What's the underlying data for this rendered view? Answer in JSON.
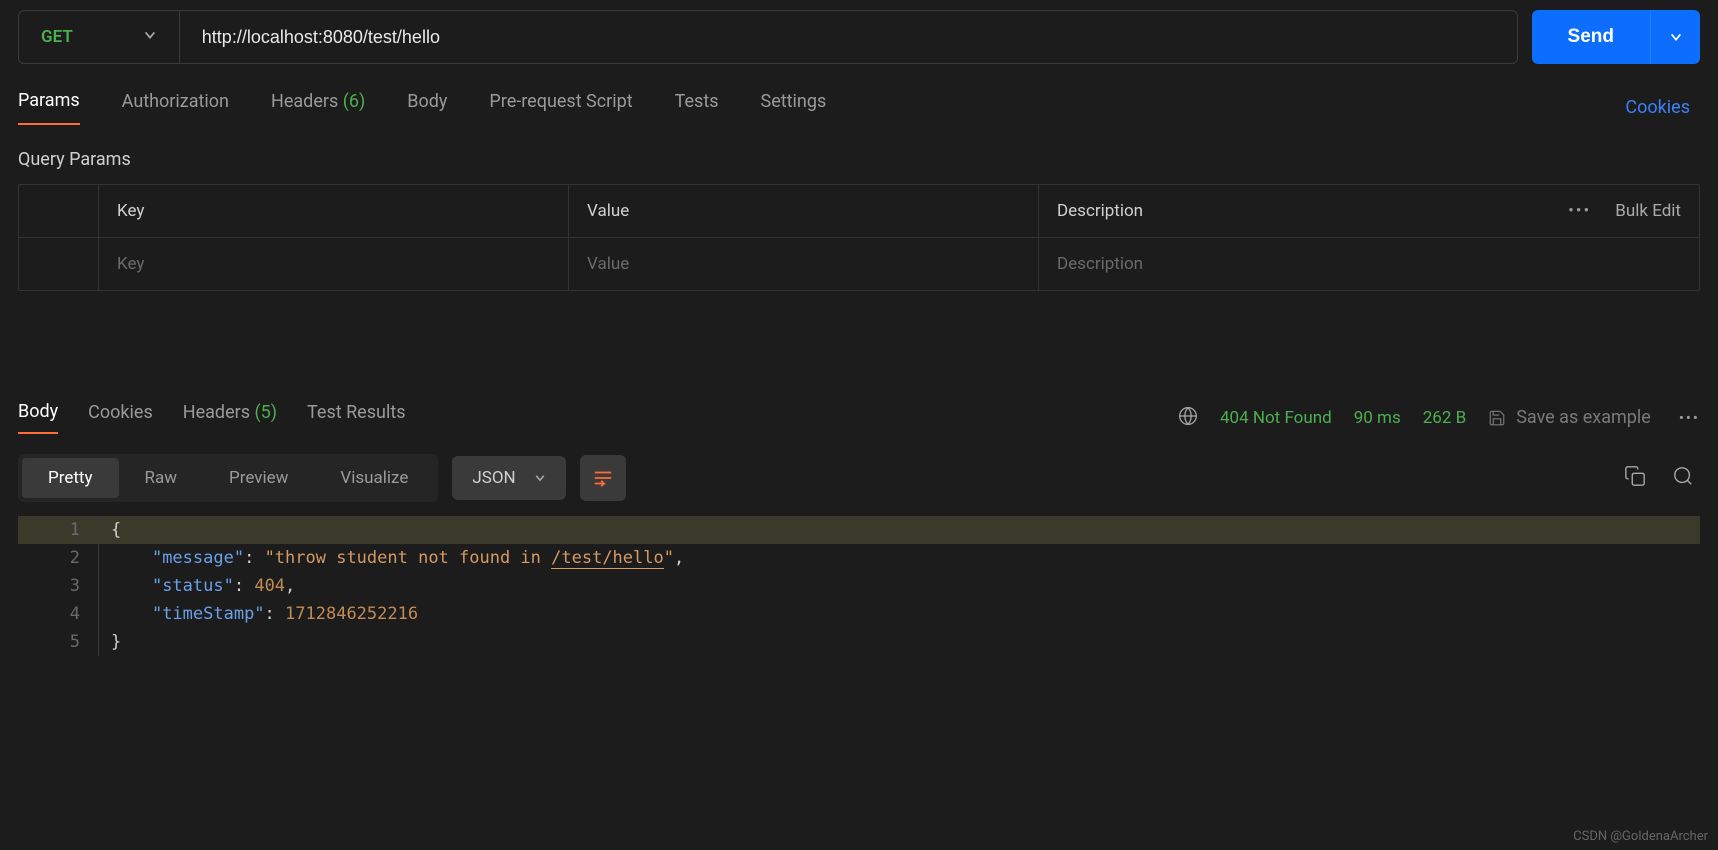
{
  "request": {
    "method": "GET",
    "url": "http://localhost:8080/test/hello",
    "send_label": "Send"
  },
  "tabs": {
    "params": "Params",
    "authorization": "Authorization",
    "headers": "Headers",
    "headers_count": "(6)",
    "body": "Body",
    "prerequest": "Pre-request Script",
    "tests": "Tests",
    "settings": "Settings",
    "cookies": "Cookies"
  },
  "query_params": {
    "title": "Query Params",
    "header_key": "Key",
    "header_value": "Value",
    "header_desc": "Description",
    "bulk_edit": "Bulk Edit",
    "ph_key": "Key",
    "ph_value": "Value",
    "ph_desc": "Description"
  },
  "response": {
    "tabs": {
      "body": "Body",
      "cookies": "Cookies",
      "headers": "Headers",
      "headers_count": "(5)",
      "test_results": "Test Results"
    },
    "status": "404 Not Found",
    "time": "90 ms",
    "size": "262 B",
    "save_example": "Save as example",
    "view": {
      "pretty": "Pretty",
      "raw": "Raw",
      "preview": "Preview",
      "visualize": "Visualize",
      "format": "JSON"
    },
    "code": {
      "l1": "{",
      "l2_key": "\"message\"",
      "l2_colon": ": ",
      "l2_val_a": "\"throw student not found in ",
      "l2_val_b": "/test/hello",
      "l2_val_c": "\"",
      "l2_comma": ",",
      "l3_key": "\"status\"",
      "l3_colon": ": ",
      "l3_val": "404",
      "l3_comma": ",",
      "l4_key": "\"timeStamp\"",
      "l4_colon": ": ",
      "l4_val": "1712846252216",
      "l5": "}",
      "n1": "1",
      "n2": "2",
      "n3": "3",
      "n4": "4",
      "n5": "5"
    }
  },
  "watermark": "CSDN @GoldenaArcher"
}
